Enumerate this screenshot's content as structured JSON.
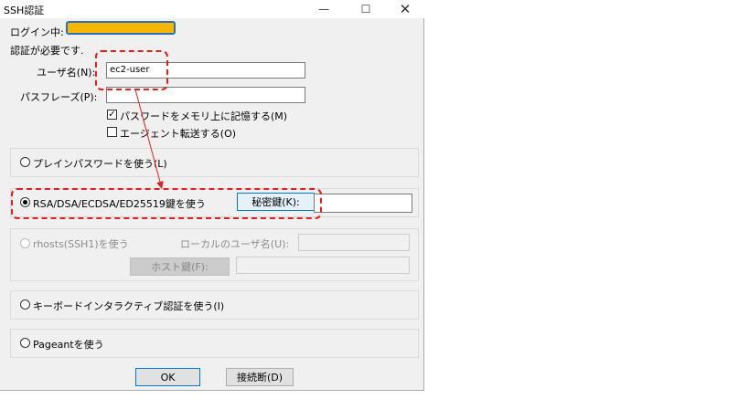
{
  "window": {
    "title": "SSH認証",
    "minimize_icon": "minimize-icon",
    "maximize_icon": "maximize-icon",
    "close_icon": "close-icon"
  },
  "login": {
    "label": "ログイン中:",
    "masked_color": "#f5b800",
    "masked_border": "#2f6fb5"
  },
  "auth_required": "認証が必要です.",
  "username": {
    "label": "ユーザ名(N):",
    "value": "ec2-user"
  },
  "passphrase": {
    "label": "パスフレーズ(P):",
    "value": ""
  },
  "remember_checkbox": {
    "label": "パスワードをメモリ上に記憶する(M)",
    "checked": true
  },
  "agent_checkbox": {
    "label": "エージェント転送する(O)",
    "checked": false
  },
  "methods": {
    "plain": "プレインパスワードを使う(L)",
    "rsa": "RSA/DSA/ECDSA/ED25519鍵を使う",
    "private_key_button": "秘密鍵(K):",
    "private_key_value": "",
    "rhosts": "rhosts(SSH1)を使う",
    "local_user_label": "ローカルのユーザ名(U):",
    "host_key_button": "ホスト鍵(F):",
    "keyboard": "キーボードインタラクティブ認証を使う(I)",
    "pageant": "Pageantを使う"
  },
  "buttons": {
    "ok": "OK",
    "disconnect": "接続断(D)"
  },
  "annotation": {
    "color": "#e41e1e"
  }
}
